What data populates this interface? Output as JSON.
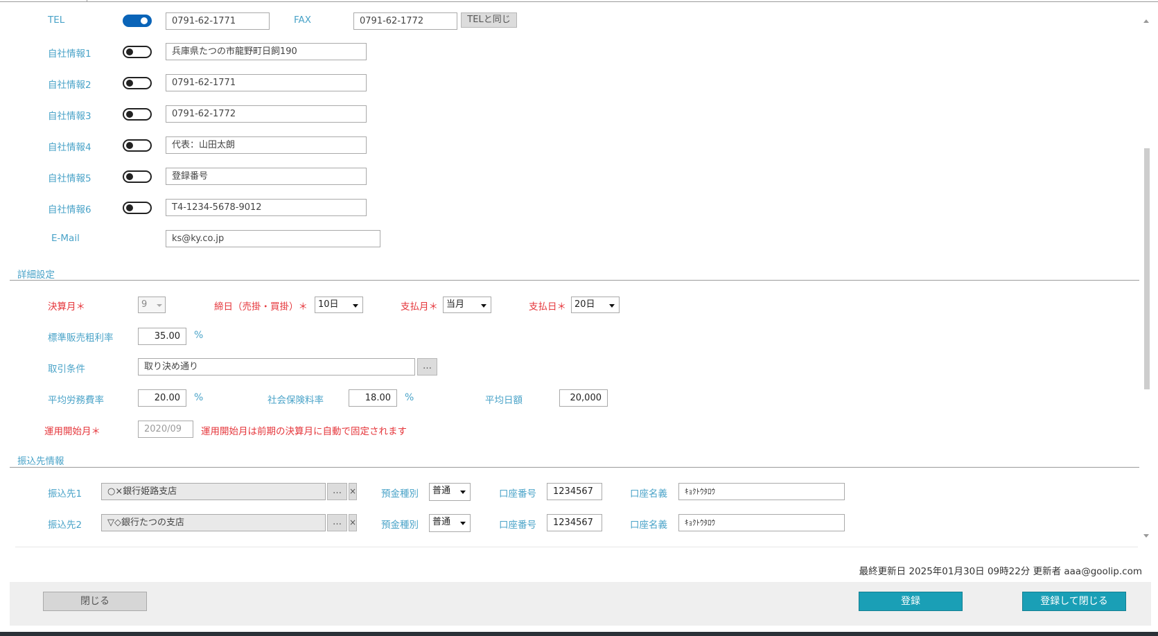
{
  "contact": {
    "tel_label": "TEL",
    "tel_value": "0791-62-1771",
    "fax_label": "FAX",
    "fax_value": "0791-62-1772",
    "same_as_tel_button": "TELと同じ",
    "company_info": [
      {
        "label": "自社情報1",
        "value": "兵庫県たつの市龍野町日飼190"
      },
      {
        "label": "自社情報2",
        "value": "0791-62-1771"
      },
      {
        "label": "自社情報3",
        "value": "0791-62-1772"
      },
      {
        "label": "自社情報4",
        "value": "代表：山田太朗"
      },
      {
        "label": "自社情報5",
        "value": "登録番号"
      },
      {
        "label": "自社情報6",
        "value": "T4-1234-5678-9012"
      }
    ],
    "email_label": "E-Mail",
    "email_value": "ks@ky.co.jp"
  },
  "detail": {
    "section_title": "詳細設定",
    "fiscal_month_label": "決算月＊",
    "fiscal_month_value": "9",
    "closing_day_label": "締日（売掛・買掛）＊",
    "closing_day_value": "10日",
    "payment_month_label": "支払月＊",
    "payment_month_value": "当月",
    "payment_day_label": "支払日＊",
    "payment_day_value": "20日",
    "gross_margin_label": "標準販売粗利率",
    "gross_margin_value": "35.00",
    "percent": "%",
    "terms_label": "取引条件",
    "terms_value": "取り決め通り",
    "ellipsis": "…",
    "labor_rate_label": "平均労務費率",
    "labor_rate_value": "20.00",
    "insurance_rate_label": "社会保険料率",
    "insurance_rate_value": "18.00",
    "daily_amount_label": "平均日額",
    "daily_amount_value": "20,000",
    "start_month_label": "運用開始月＊",
    "start_month_value": "2020/09",
    "start_month_note": "運用開始月は前期の決算月に自動で固定されます"
  },
  "bank": {
    "section_title": "振込先情報",
    "rows": [
      {
        "label": "振込先1",
        "bank": "○×銀行姫路支店",
        "deposit_label": "預金種別",
        "deposit_type": "普通",
        "account_no_label": "口座番号",
        "account_no": "1234567",
        "holder_label": "口座名義",
        "holder": "ｷｮｸﾄｳﾀﾛｳ"
      },
      {
        "label": "振込先2",
        "bank": "▽◇銀行たつの支店",
        "deposit_label": "預金種別",
        "deposit_type": "普通",
        "account_no_label": "口座番号",
        "account_no": "1234567",
        "holder_label": "口座名義",
        "holder": "ｷｮｸﾄｳﾀﾛｳ"
      }
    ],
    "clear": "×"
  },
  "footer": {
    "last_updated": "最終更新日 2025年01月30日 09時22分 更新者 aaa@goolip.com",
    "close_button": "閉じる",
    "register_button": "登録",
    "register_close_button": "登録して閉じる"
  },
  "colors": {
    "accent": "#4aa3c8",
    "required": "#e5363b",
    "primary": "#1a9fb6",
    "toggle_on": "#0a64b8"
  }
}
